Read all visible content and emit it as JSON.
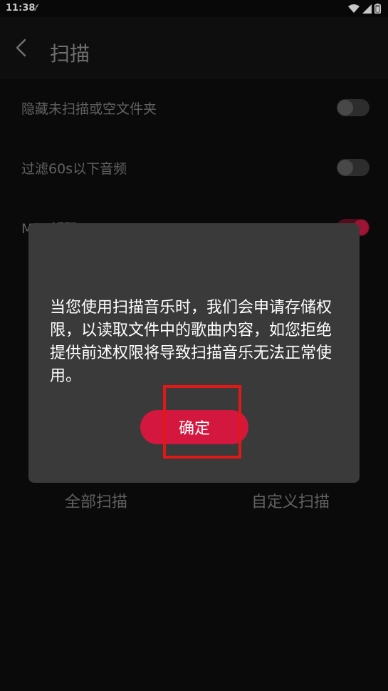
{
  "status_bar": {
    "time": "11:38",
    "notification_glyph": "𝑓"
  },
  "app_bar": {
    "title": "扫描"
  },
  "settings": {
    "items": [
      {
        "label": "隐藏未扫描或空文件夹",
        "enabled": false
      },
      {
        "label": "过滤60s以下音频",
        "enabled": false
      },
      {
        "label": "M… 解码",
        "enabled": true
      }
    ]
  },
  "scan_actions": {
    "all_label": "全部扫描",
    "custom_label": "自定义扫描"
  },
  "dialog": {
    "message": "当您使用扫描音乐时，我们会申请存储权限，以读取文件中的歌曲内容，如您拒绝提供前述权限将导致扫描音乐无法正常使用。",
    "confirm_label": "确定"
  },
  "colors": {
    "accent": "#d4173f",
    "annotation": "#e01818"
  },
  "icons": [
    "back-arrow-icon",
    "wifi-icon",
    "signal-icon",
    "battery-icon",
    "info-icon"
  ]
}
